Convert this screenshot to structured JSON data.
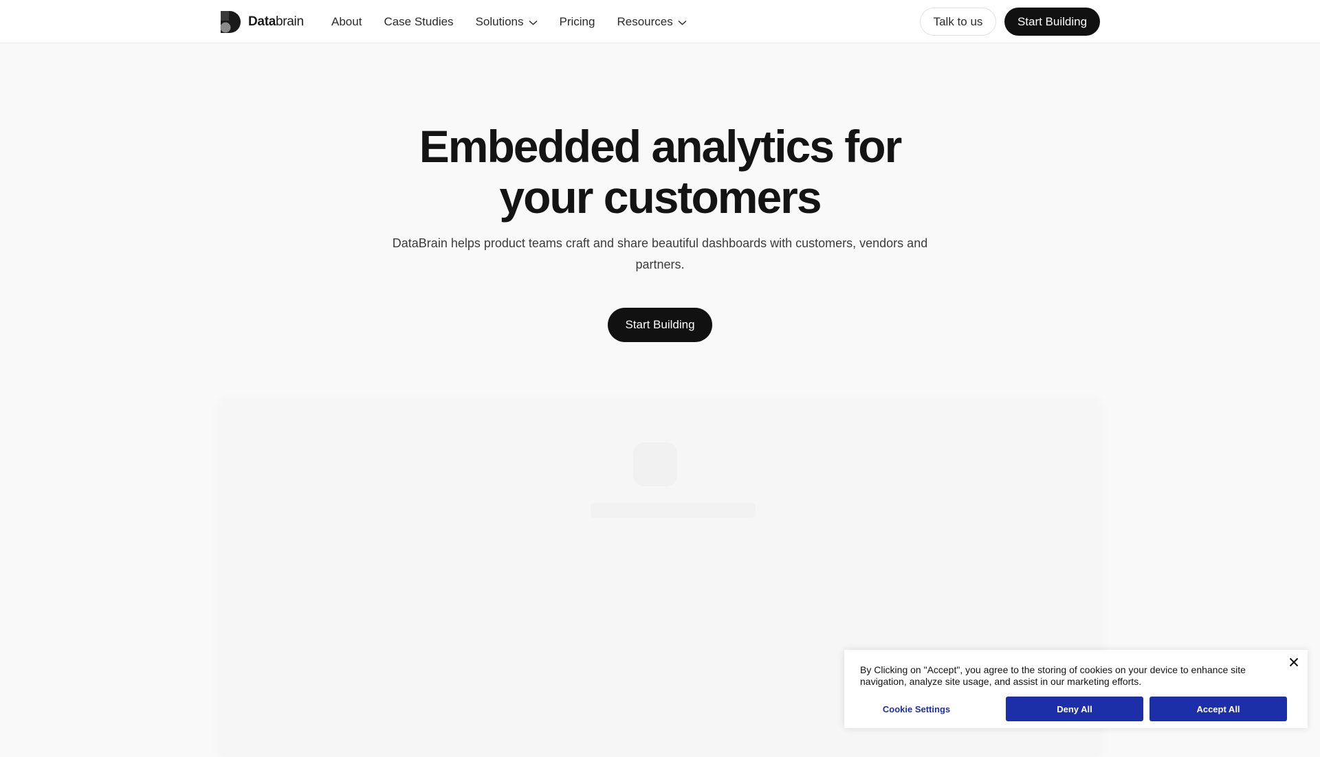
{
  "header": {
    "logo": {
      "brand_bold": "Data",
      "brand_light": "brain"
    },
    "nav": [
      {
        "label": "About",
        "has_dropdown": false
      },
      {
        "label": "Case Studies",
        "has_dropdown": false
      },
      {
        "label": "Solutions",
        "has_dropdown": true
      },
      {
        "label": "Pricing",
        "has_dropdown": false
      },
      {
        "label": "Resources",
        "has_dropdown": true
      }
    ],
    "talk_label": "Talk to us",
    "start_label": "Start Building"
  },
  "hero": {
    "title": "Embedded analytics for your customers",
    "subtitle": "DataBrain helps product teams craft and share beautiful dashboards with customers, vendors and partners.",
    "cta_label": "Start Building"
  },
  "cookie": {
    "text": "By Clicking on \"Accept\", you agree to the storing of cookies on your device to enhance site navigation, analyze site usage, and assist in our marketing efforts.",
    "settings_label": "Cookie Settings",
    "deny_label": "Deny All",
    "accept_label": "Accept All"
  },
  "colors": {
    "primary_dark": "#111111",
    "cookie_accent": "#1d2fa8",
    "page_background": "#f9f9f9"
  }
}
